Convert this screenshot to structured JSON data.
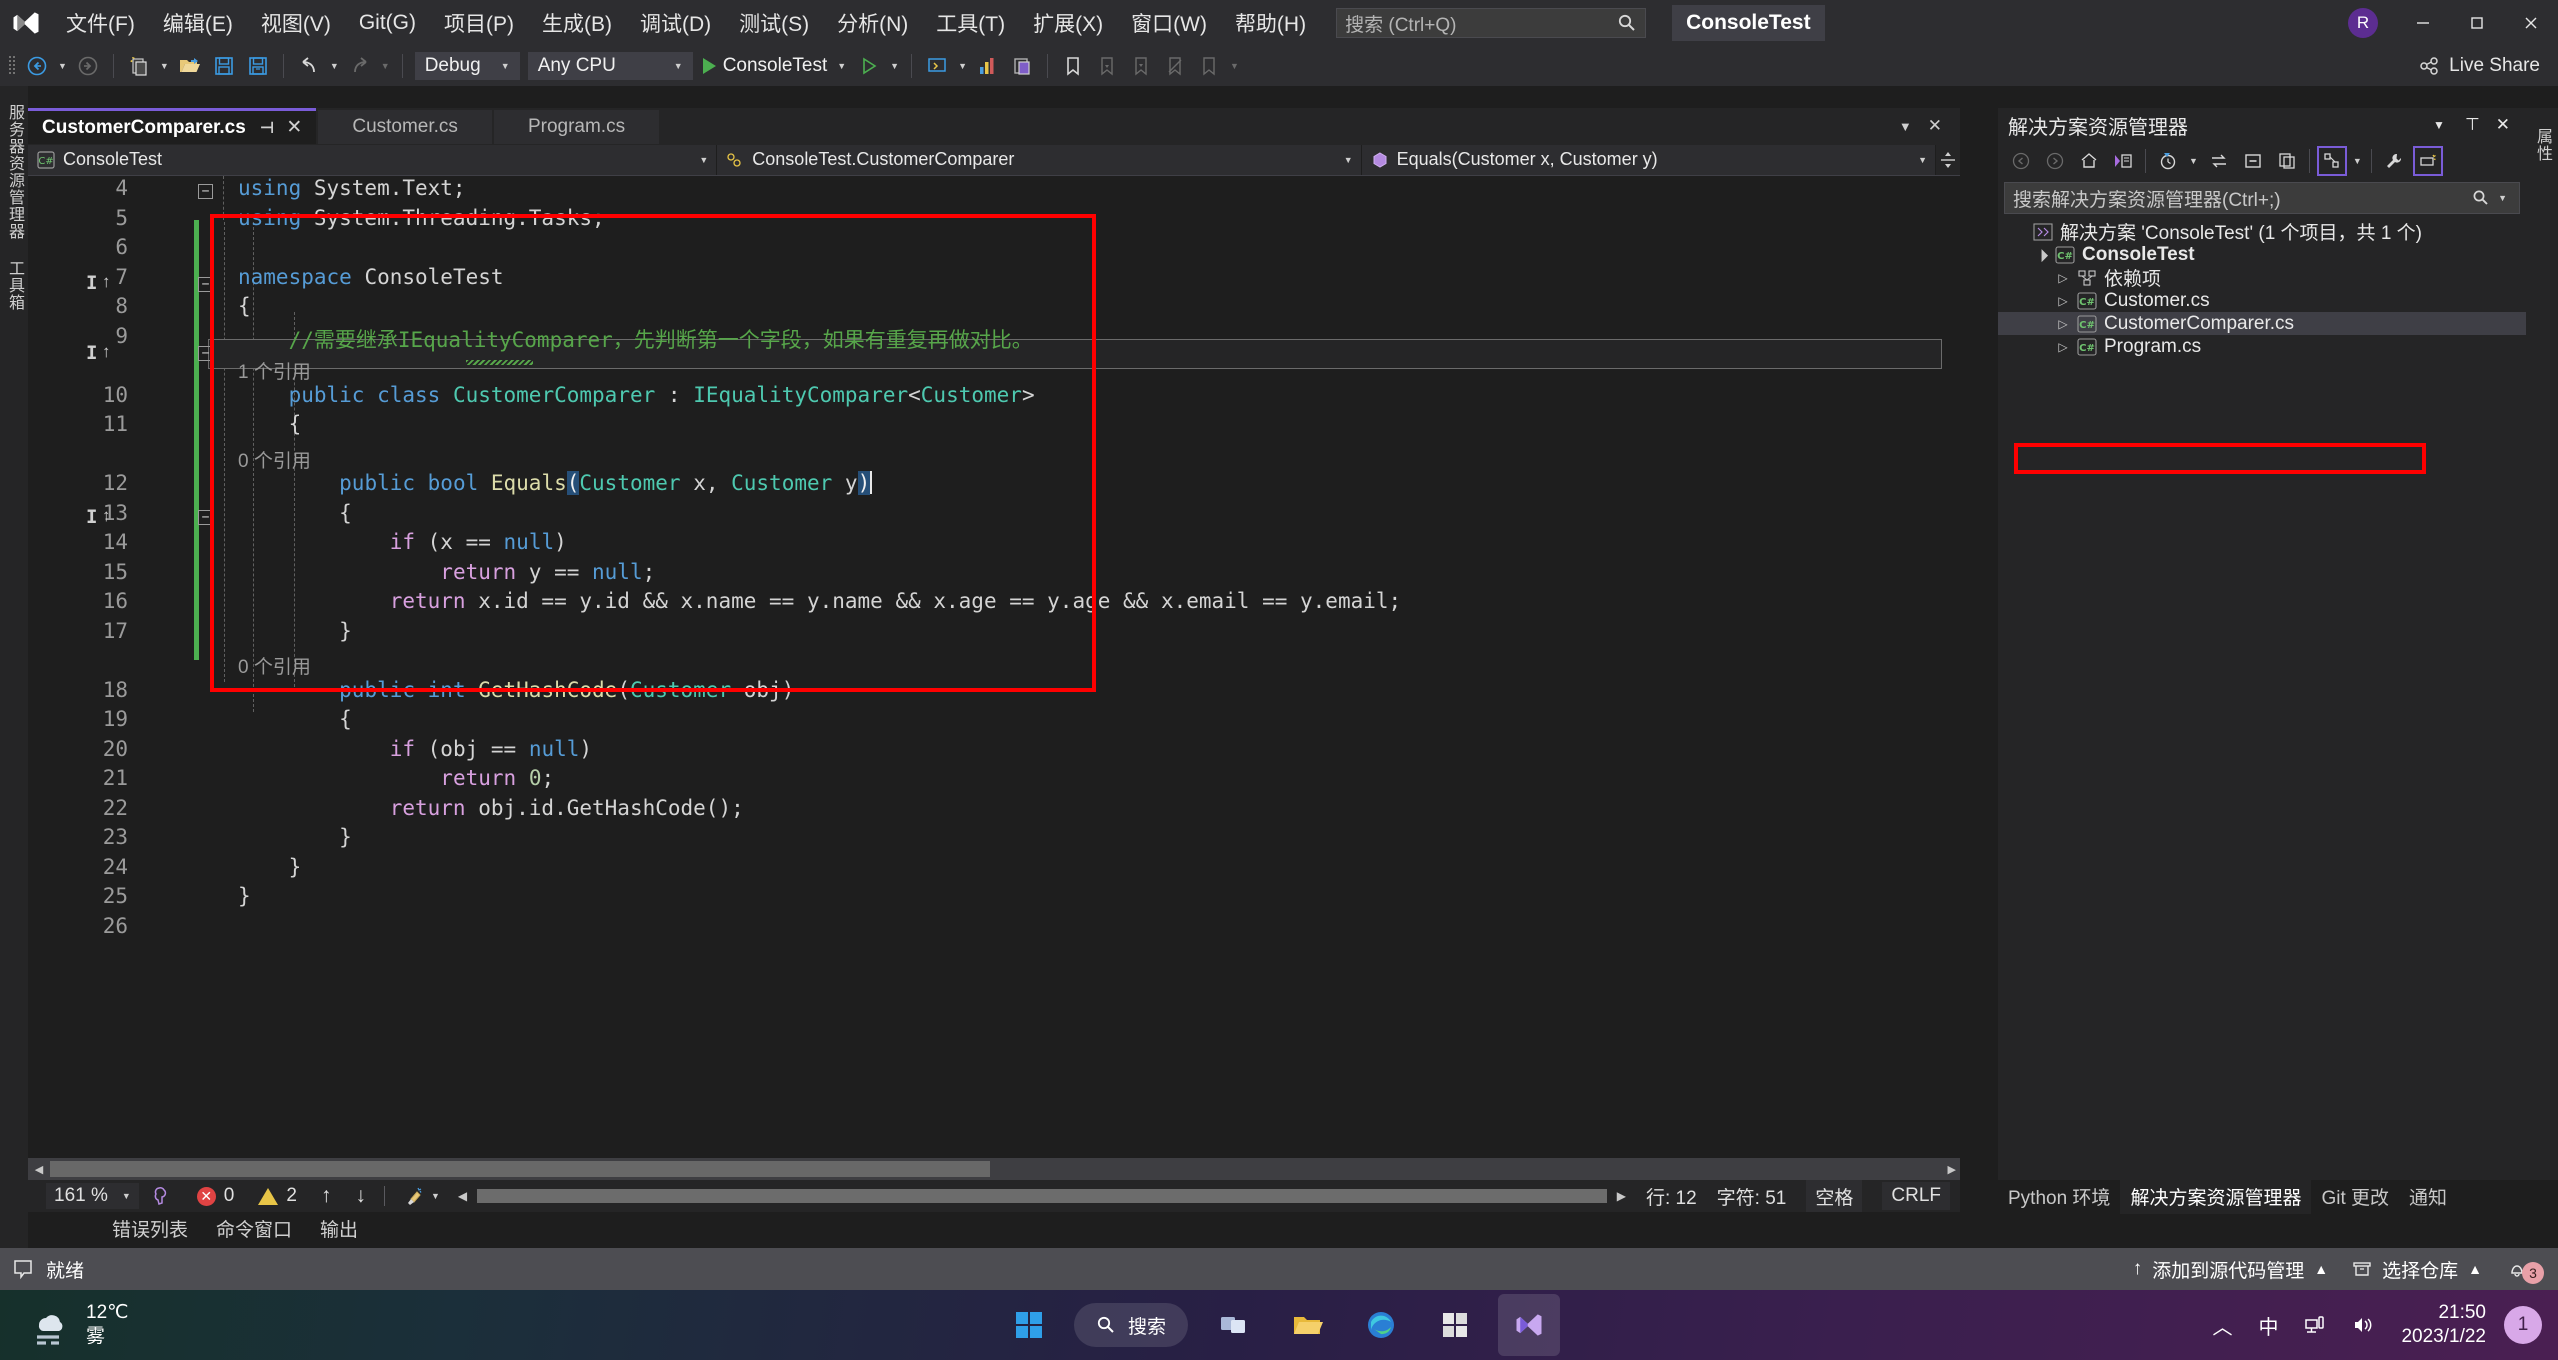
{
  "titlebar": {
    "logo_icon": "visual-studio-logo",
    "menus": [
      "文件(F)",
      "编辑(E)",
      "视图(V)",
      "Git(G)",
      "项目(P)",
      "生成(B)",
      "调试(D)",
      "测试(S)",
      "分析(N)",
      "工具(T)",
      "扩展(X)",
      "窗口(W)",
      "帮助(H)"
    ],
    "search_placeholder": "搜索 (Ctrl+Q)",
    "search_icon": "search-icon",
    "window_title": "ConsoleTest",
    "account_initial": "R",
    "minimize_icon": "minimize-icon",
    "maximize_icon": "maximize-icon",
    "close_icon": "close-icon"
  },
  "toolbar": {
    "back_icon": "navigate-back-icon",
    "forward_icon": "navigate-forward-icon",
    "new_project_icon": "new-project-icon",
    "open_file_icon": "open-file-icon",
    "save_icon": "save-icon",
    "save_all_icon": "save-all-icon",
    "undo_icon": "undo-icon",
    "redo_icon": "redo-icon",
    "configuration": "Debug",
    "platform": "Any CPU",
    "start_label": "ConsoleTest",
    "live_share_label": "Live Share",
    "live_share_icon": "live-share-icon"
  },
  "left_dock": {
    "items": [
      "服务器资源管理器",
      "工具箱"
    ]
  },
  "tabs": {
    "items": [
      {
        "label": "CustomerComparer.cs",
        "active": true,
        "pin_icon": "pin-icon",
        "close_icon": "close-icon"
      },
      {
        "label": "Customer.cs",
        "active": false
      },
      {
        "label": "Program.cs",
        "active": false
      }
    ]
  },
  "navbar": {
    "project": "ConsoleTest",
    "project_icon": "csharp-file-icon",
    "type": "ConsoleTest.CustomerComparer",
    "type_icon": "class-icon",
    "member": "Equals(Customer x, Customer y)",
    "member_icon": "method-icon",
    "split_icon": "split-view-icon"
  },
  "editor": {
    "lines": [
      {
        "num": "4",
        "tokens": [
          {
            "t": "using ",
            "c": "kw"
          },
          {
            "t": "System.Text;",
            "c": "pl"
          }
        ]
      },
      {
        "num": "5",
        "tokens": [
          {
            "t": "using ",
            "c": "kw"
          },
          {
            "t": "System.Threading.Tasks;",
            "c": "pl"
          }
        ]
      },
      {
        "num": "6",
        "tokens": []
      },
      {
        "num": "7",
        "tokens": [
          {
            "t": "namespace ",
            "c": "kw"
          },
          {
            "t": "ConsoleTest",
            "c": "pl"
          }
        ]
      },
      {
        "num": "8",
        "tokens": [
          {
            "t": "{",
            "c": "pl"
          }
        ]
      },
      {
        "num": "9",
        "tokens": [
          {
            "t": "    //需要继承IEqualityComparer，先判断第一个字段，如果有重复再做对比。",
            "c": "cmt"
          }
        ]
      },
      {
        "num": "10",
        "tokens": [
          {
            "t": "    ",
            "c": "pl"
          },
          {
            "t": "public class ",
            "c": "kw"
          },
          {
            "t": "CustomerComparer",
            "c": "cls"
          },
          {
            "t": " : ",
            "c": "pl"
          },
          {
            "t": "IEqualityComparer",
            "c": "cls"
          },
          {
            "t": "<",
            "c": "pl"
          },
          {
            "t": "Customer",
            "c": "cls"
          },
          {
            "t": ">",
            "c": "pl"
          }
        ]
      },
      {
        "num": "11",
        "tokens": [
          {
            "t": "    {",
            "c": "pl"
          }
        ]
      },
      {
        "num": "12",
        "tokens": [
          {
            "t": "        ",
            "c": "pl"
          },
          {
            "t": "public bool ",
            "c": "kw"
          },
          {
            "t": "Equals",
            "c": "mth"
          },
          {
            "t": "(",
            "c": "sel"
          },
          {
            "t": "Customer",
            "c": "cls"
          },
          {
            "t": " x, ",
            "c": "pl"
          },
          {
            "t": "Customer",
            "c": "cls"
          },
          {
            "t": " y",
            "c": "pl"
          },
          {
            "t": ")",
            "c": "sel"
          }
        ]
      },
      {
        "num": "13",
        "tokens": [
          {
            "t": "        {",
            "c": "pl"
          }
        ]
      },
      {
        "num": "14",
        "tokens": [
          {
            "t": "            ",
            "c": "pl"
          },
          {
            "t": "if",
            "c": "ctl"
          },
          {
            "t": " (x == ",
            "c": "pl"
          },
          {
            "t": "null",
            "c": "kw"
          },
          {
            "t": ")",
            "c": "pl"
          }
        ]
      },
      {
        "num": "15",
        "tokens": [
          {
            "t": "                ",
            "c": "pl"
          },
          {
            "t": "return",
            "c": "ctl"
          },
          {
            "t": " y == ",
            "c": "pl"
          },
          {
            "t": "null",
            "c": "kw"
          },
          {
            "t": ";",
            "c": "pl"
          }
        ]
      },
      {
        "num": "16",
        "tokens": [
          {
            "t": "            ",
            "c": "pl"
          },
          {
            "t": "return",
            "c": "ctl"
          },
          {
            "t": " x.id == y.id && x.name == y.name && x.age == y.age && x.email == y.email;",
            "c": "pl"
          }
        ]
      },
      {
        "num": "17",
        "tokens": [
          {
            "t": "        }",
            "c": "pl"
          }
        ]
      },
      {
        "num": "18",
        "tokens": [
          {
            "t": "        ",
            "c": "pl"
          },
          {
            "t": "public int ",
            "c": "kw"
          },
          {
            "t": "GetHashCode",
            "c": "mth"
          },
          {
            "t": "(",
            "c": "pl"
          },
          {
            "t": "Customer",
            "c": "cls"
          },
          {
            "t": " obj)",
            "c": "pl"
          }
        ]
      },
      {
        "num": "19",
        "tokens": [
          {
            "t": "        {",
            "c": "pl"
          }
        ]
      },
      {
        "num": "20",
        "tokens": [
          {
            "t": "            ",
            "c": "pl"
          },
          {
            "t": "if",
            "c": "ctl"
          },
          {
            "t": " (obj == ",
            "c": "pl"
          },
          {
            "t": "null",
            "c": "kw"
          },
          {
            "t": ")",
            "c": "pl"
          }
        ]
      },
      {
        "num": "21",
        "tokens": [
          {
            "t": "                ",
            "c": "pl"
          },
          {
            "t": "return",
            "c": "ctl"
          },
          {
            "t": " ",
            "c": "pl"
          },
          {
            "t": "0",
            "c": "num"
          },
          {
            "t": ";",
            "c": "pl"
          }
        ]
      },
      {
        "num": "22",
        "tokens": [
          {
            "t": "            ",
            "c": "pl"
          },
          {
            "t": "return",
            "c": "ctl"
          },
          {
            "t": " obj.id.GetHashCode();",
            "c": "pl"
          }
        ]
      },
      {
        "num": "23",
        "tokens": [
          {
            "t": "        }",
            "c": "pl"
          }
        ]
      },
      {
        "num": "24",
        "tokens": [
          {
            "t": "    }",
            "c": "pl"
          }
        ]
      },
      {
        "num": "25",
        "tokens": [
          {
            "t": "}",
            "c": "pl"
          }
        ]
      },
      {
        "num": "26",
        "tokens": []
      }
    ],
    "codelens": [
      {
        "after_line": "9",
        "text": "1 个引用"
      },
      {
        "after_line": "11",
        "text": "0 个引用"
      },
      {
        "after_line": "17",
        "text": "0 个引用"
      }
    ],
    "annotation_color": "#ff0000"
  },
  "solution_explorer": {
    "title": "解决方案资源管理器",
    "dropdown_icon": "chevron-down-icon",
    "pin_icon": "pin-icon",
    "close_icon": "close-icon",
    "toolbar_icons": [
      "back-icon",
      "forward-icon",
      "home-icon",
      "switch-views-icon",
      "pending-changes-icon",
      "chevron-down-icon",
      "sync-with-active-icon",
      "collapse-all-icon",
      "show-all-files-icon",
      "solution-explorer-filter-icon",
      "chevron-down-icon",
      "properties-icon",
      "preview-selected-items-icon"
    ],
    "search_placeholder": "搜索解决方案资源管理器(Ctrl+;)",
    "search_icon": "search-icon",
    "tree": [
      {
        "label": "解决方案 'ConsoleTest' (1 个项目，共 1 个)",
        "indent": 0,
        "icon": "solution-icon",
        "expander": "none",
        "bold": false
      },
      {
        "label": "ConsoleTest",
        "indent": 1,
        "icon": "csharp-project-icon",
        "expander": "expanded",
        "bold": true
      },
      {
        "label": "依赖项",
        "indent": 2,
        "icon": "dependencies-icon",
        "expander": "collapsed",
        "bold": false
      },
      {
        "label": "Customer.cs",
        "indent": 2,
        "icon": "csharp-file-icon",
        "expander": "collapsed",
        "bold": false
      },
      {
        "label": "CustomerComparer.cs",
        "indent": 2,
        "icon": "csharp-file-icon",
        "expander": "collapsed",
        "bold": false,
        "selected": true,
        "highlighted": true
      },
      {
        "label": "Program.cs",
        "indent": 2,
        "icon": "csharp-file-icon",
        "expander": "collapsed",
        "bold": false
      }
    ]
  },
  "right_dock": {
    "items": [
      "属性"
    ]
  },
  "edit_status": {
    "zoom": "161 %",
    "zoom_caret_icon": "chevron-down-icon",
    "brain_icon": "intellicode-icon",
    "error_count": "0",
    "warning_count": "2",
    "prev_icon": "arrow-up-icon",
    "next_icon": "arrow-down-icon",
    "broom_icon": "code-cleanup-icon",
    "line_label": "行: 12",
    "char_label": "字符: 51",
    "indent_label": "空格",
    "eol_label": "CRLF"
  },
  "dock_tabs": {
    "left": [
      "错误列表",
      "命令窗口",
      "输出"
    ],
    "right": [
      {
        "label": "Python 环境",
        "active": false
      },
      {
        "label": "解决方案资源管理器",
        "active": true
      },
      {
        "label": "Git 更改",
        "active": false
      },
      {
        "label": "通知",
        "active": false
      }
    ]
  },
  "vs_status": {
    "ready_icon": "ready-flag-icon",
    "ready_label": "就绪",
    "source_control_label": "添加到源代码管理",
    "source_control_caret": "▲",
    "repo_icon": "repository-icon",
    "repo_label": "选择仓库",
    "repo_caret": "▲",
    "bell_icon": "bell-icon",
    "notification_count": "3",
    "background_color": "#4d4d52"
  },
  "taskbar": {
    "weather_icon": "fog-weather-icon",
    "temperature": "12℃",
    "condition": "雾",
    "start_icon": "windows-start-icon",
    "search_icon": "search-icon",
    "search_label": "搜索",
    "taskview_icon": "task-view-icon",
    "explorer_icon": "file-explorer-icon",
    "edge_icon": "microsoft-edge-icon",
    "store_icon": "microsoft-store-icon",
    "vs_icon": "visual-studio-taskbar-icon",
    "chevron_icon": "show-hidden-icons-icon",
    "ime_label": "中",
    "network_icon": "network-icon",
    "volume_icon": "volume-icon",
    "time": "21:50",
    "date": "2023/1/22",
    "badge_count": "1"
  }
}
